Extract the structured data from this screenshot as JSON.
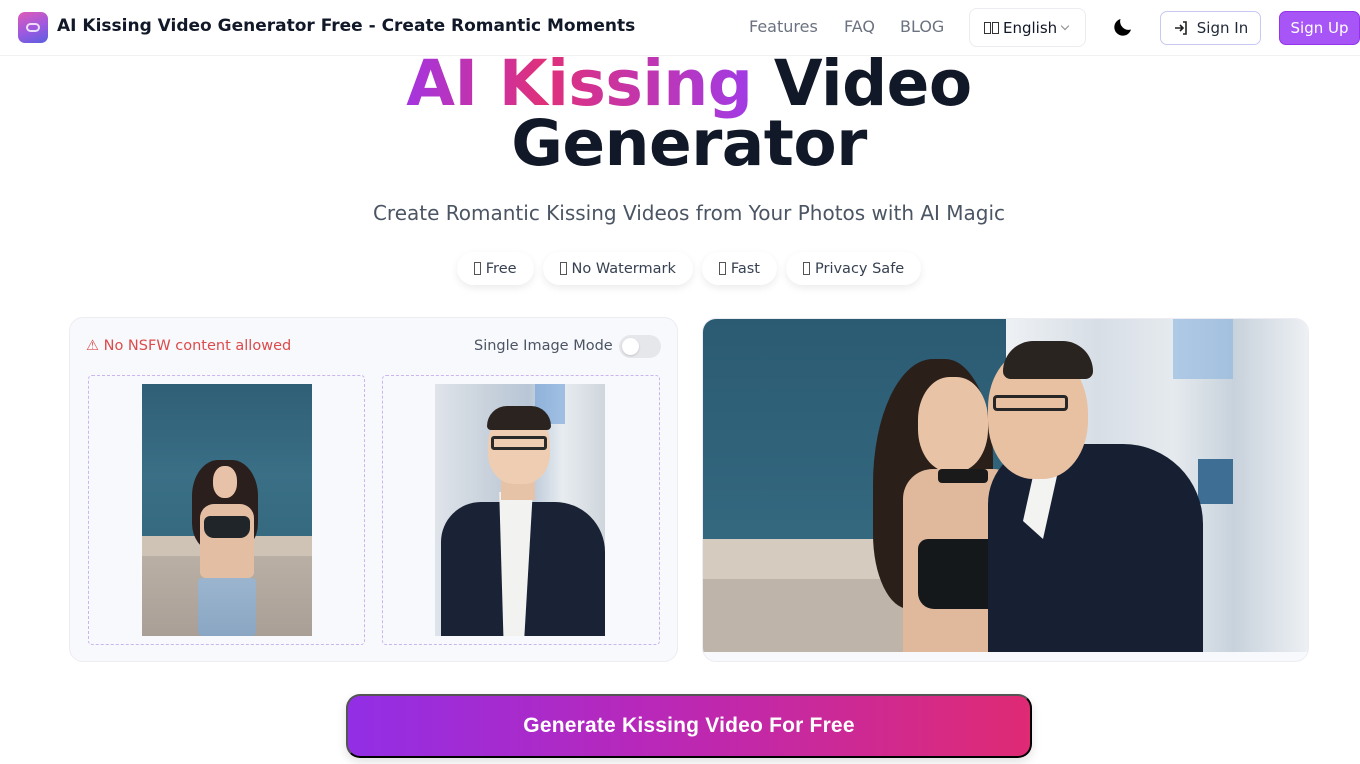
{
  "header": {
    "brand_title": "AI Kissing Video Generator Free - Create Romantic Moments",
    "logo_icon": "heart-link-icon",
    "nav": [
      {
        "label": "Features"
      },
      {
        "label": "FAQ"
      },
      {
        "label": "BLOG"
      }
    ],
    "language": {
      "selected": "English",
      "icon": "flag-icon"
    },
    "theme_icon": "moon-icon",
    "sign_in_label": "Sign In",
    "sign_in_icon": "login-arrow-icon",
    "sign_up_label": "Sign Up"
  },
  "hero": {
    "title_gradient": "AI Kissing",
    "title_rest_line1": " Video",
    "title_line2": "Generator",
    "subtitle": "Create Romantic Kissing Videos from Your Photos with AI Magic",
    "badges": [
      {
        "label": "Free",
        "icon": "emoji-icon"
      },
      {
        "label": "No Watermark",
        "icon": "emoji-icon"
      },
      {
        "label": "Fast",
        "icon": "emoji-icon"
      },
      {
        "label": "Privacy Safe",
        "icon": "emoji-icon"
      }
    ]
  },
  "upload": {
    "warning": "⚠ No NSFW content allowed",
    "single_mode_label": "Single Image Mode",
    "single_mode_on": false,
    "slots": [
      {
        "name": "first-person-photo",
        "description": "woman in black top and jeans against blue wall"
      },
      {
        "name": "second-person-photo",
        "description": "man in glasses and dark suit"
      }
    ]
  },
  "result": {
    "description": "example kissing video preview of the couple"
  },
  "generate_label": "Generate Kissing Video For Free",
  "colors": {
    "accent_purple": "#a855f7",
    "gradient_start": "#922ee6",
    "gradient_end": "#df2a74",
    "warning_red": "#dc4b4b",
    "dropzone_border": "#c9b6ef"
  }
}
